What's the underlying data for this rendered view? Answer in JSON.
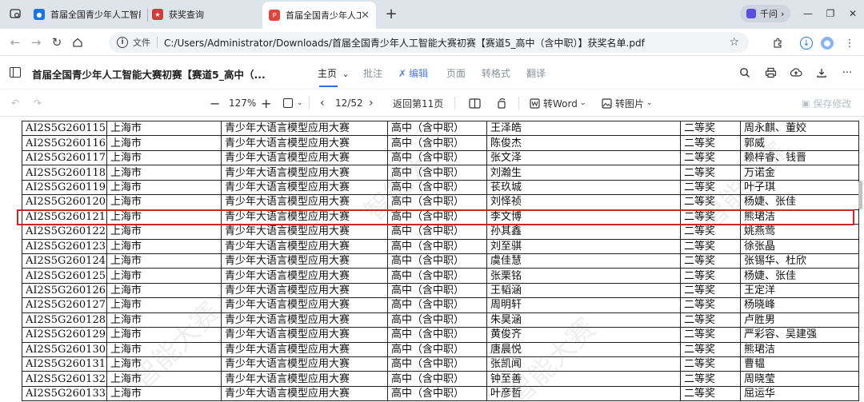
{
  "browser": {
    "tabs": [
      {
        "title": "首届全国青少年人工智能",
        "active": false
      },
      {
        "title": "获奖查询",
        "active": false
      },
      {
        "title": "首届全国青少年人工",
        "active": true
      }
    ],
    "qianwen_label": "千问",
    "file_label": "文件",
    "url": "C:/Users/Administrator/Downloads/首届全国青少年人工智能大赛初赛【赛道5_高中（含中职）】获奖名单.pdf"
  },
  "pdf": {
    "title": "首届全国青少年人工智能大赛初赛【赛道5_高中（...",
    "menu": {
      "home": "主页",
      "annotate": "批注",
      "edit": "编辑",
      "page": "页面",
      "convert": "转格式",
      "translate": "翻译"
    },
    "toolbar": {
      "zoom": "127%",
      "page_current": "12",
      "page_total": "52",
      "page_display": "12/52",
      "back_to_page": "返回第11页",
      "to_word": "转Word",
      "to_image": "转图片",
      "save_changes": "保存修改"
    },
    "watermark": "智能大赛",
    "highlighted_row_id": "AI2S5G260121",
    "rows": [
      {
        "id": "AI2S5G260115",
        "region": "上海市",
        "contest": "青少年大语言模型应用大赛",
        "level": "高中（含中职）",
        "student": "王泽皓",
        "award": "二等奖",
        "teacher": "周永麒、董姣"
      },
      {
        "id": "AI2S5G260116",
        "region": "上海市",
        "contest": "青少年大语言模型应用大赛",
        "level": "高中（含中职）",
        "student": "陈俊杰",
        "award": "二等奖",
        "teacher": "郭威"
      },
      {
        "id": "AI2S5G260117",
        "region": "上海市",
        "contest": "青少年大语言模型应用大赛",
        "level": "高中（含中职）",
        "student": "张文泽",
        "award": "二等奖",
        "teacher": "赖梓睿、钱晋"
      },
      {
        "id": "AI2S5G260118",
        "region": "上海市",
        "contest": "青少年大语言模型应用大赛",
        "level": "高中（含中职）",
        "student": "刘瀚生",
        "award": "二等奖",
        "teacher": "万诺金"
      },
      {
        "id": "AI2S5G260119",
        "region": "上海市",
        "contest": "青少年大语言模型应用大赛",
        "level": "高中（含中职）",
        "student": "苌玖城",
        "award": "二等奖",
        "teacher": "叶子琪"
      },
      {
        "id": "AI2S5G260120",
        "region": "上海市",
        "contest": "青少年大语言模型应用大赛",
        "level": "高中（含中职）",
        "student": "刘怿祯",
        "award": "二等奖",
        "teacher": "杨婕、张佳"
      },
      {
        "id": "AI2S5G260121",
        "region": "上海市",
        "contest": "青少年大语言模型应用大赛",
        "level": "高中（含中职）",
        "student": "李文博",
        "award": "二等奖",
        "teacher": "熊珺洁"
      },
      {
        "id": "AI2S5G260122",
        "region": "上海市",
        "contest": "青少年大语言模型应用大赛",
        "level": "高中（含中职）",
        "student": "孙其鑫",
        "award": "二等奖",
        "teacher": "姚燕莺"
      },
      {
        "id": "AI2S5G260123",
        "region": "上海市",
        "contest": "青少年大语言模型应用大赛",
        "level": "高中（含中职）",
        "student": "刘至骐",
        "award": "二等奖",
        "teacher": "徐张晶"
      },
      {
        "id": "AI2S5G260124",
        "region": "上海市",
        "contest": "青少年大语言模型应用大赛",
        "level": "高中（含中职）",
        "student": "虞佳慧",
        "award": "二等奖",
        "teacher": "张锡华、杜欣"
      },
      {
        "id": "AI2S5G260125",
        "region": "上海市",
        "contest": "青少年大语言模型应用大赛",
        "level": "高中（含中职）",
        "student": "张栗铭",
        "award": "二等奖",
        "teacher": "杨婕、张佳"
      },
      {
        "id": "AI2S5G260126",
        "region": "上海市",
        "contest": "青少年大语言模型应用大赛",
        "level": "高中（含中职）",
        "student": "王韬涵",
        "award": "二等奖",
        "teacher": "王定洋"
      },
      {
        "id": "AI2S5G260127",
        "region": "上海市",
        "contest": "青少年大语言模型应用大赛",
        "level": "高中（含中职）",
        "student": "周明轩",
        "award": "二等奖",
        "teacher": "杨晓峰"
      },
      {
        "id": "AI2S5G260128",
        "region": "上海市",
        "contest": "青少年大语言模型应用大赛",
        "level": "高中（含中职）",
        "student": "朱昊涵",
        "award": "二等奖",
        "teacher": "卢胜男"
      },
      {
        "id": "AI2S5G260129",
        "region": "上海市",
        "contest": "青少年大语言模型应用大赛",
        "level": "高中（含中职）",
        "student": "黄俊齐",
        "award": "二等奖",
        "teacher": "严彩容、吴建强"
      },
      {
        "id": "AI2S5G260130",
        "region": "上海市",
        "contest": "青少年大语言模型应用大赛",
        "level": "高中（含中职）",
        "student": "唐晨悦",
        "award": "二等奖",
        "teacher": "熊珺洁"
      },
      {
        "id": "AI2S5G260131",
        "region": "上海市",
        "contest": "青少年大语言模型应用大赛",
        "level": "高中（含中职）",
        "student": "张凯闻",
        "award": "二等奖",
        "teacher": "曹韫"
      },
      {
        "id": "AI2S5G260132",
        "region": "上海市",
        "contest": "青少年大语言模型应用大赛",
        "level": "高中（含中职）",
        "student": "钟至善",
        "award": "二等奖",
        "teacher": "周晓莹"
      },
      {
        "id": "AI2S5G260133",
        "region": "上海市",
        "contest": "青少年大语言模型应用大赛",
        "level": "高中（含中职）",
        "student": "叶彦哲",
        "award": "二等奖",
        "teacher": "屈运华"
      }
    ]
  },
  "colors": {
    "highlight": "#c62828",
    "accent": "#2f6bff",
    "tabstrip": "#dfe3ea"
  },
  "icons": [
    "tab-search-icon",
    "chrome-favicon-icon",
    "page-favicon-icon",
    "pdf-favicon-icon",
    "back-icon",
    "forward-icon",
    "refresh-icon",
    "home-icon",
    "info-icon",
    "star-icon",
    "extensions-icon",
    "download-icon",
    "profile-icon",
    "menu-icon",
    "sidebar-icon",
    "search-icon",
    "print-icon",
    "upload-icon",
    "save-icon",
    "more-icon",
    "undo-icon",
    "redo-icon",
    "zoom-out-icon",
    "zoom-in-icon",
    "fit-icon",
    "prev-page-icon",
    "next-page-icon",
    "compare-icon",
    "rotate-icon",
    "word-icon",
    "image-icon"
  ]
}
